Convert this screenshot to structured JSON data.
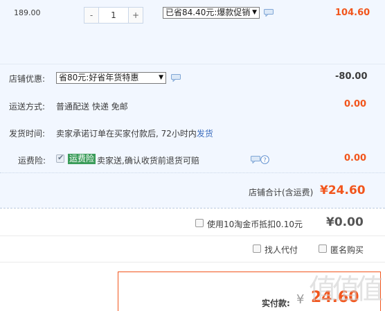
{
  "item": {
    "unit_price": "189.00",
    "qty_minus": "-",
    "qty_value": "1",
    "qty_plus": "+",
    "promo_selected": "已省84.40元:爆款促销",
    "amount": "104.60"
  },
  "shop": {
    "discount_label": "店铺优惠:",
    "discount_selected": "省80元:好省年货特惠",
    "discount_amount": "-80.00",
    "shipping_label": "运送方式:",
    "shipping_text": "普通配送 快递 免邮",
    "shipping_amount": "0.00",
    "dispatch_label": "发货时间:",
    "dispatch_text": "卖家承诺订单在买家付款后, 72小时内",
    "dispatch_link": "发货",
    "insurance_label": "运费险:",
    "insurance_tag": "运费险",
    "insurance_text": "卖家送,确认收货前退货可赔",
    "insurance_amount": "0.00",
    "subtotal_label": "店铺合计(含运费)",
    "subtotal_value": "¥24.60"
  },
  "coins": {
    "label": "使用10淘金币抵扣0.10元",
    "value": "¥0.00"
  },
  "options": {
    "proxy_pay": "找人代付",
    "anonymous": "匿名购买"
  },
  "pay": {
    "label": "实付款:",
    "yen": "¥",
    "value": "24.60"
  },
  "watermark": "值值值",
  "colors": {
    "accent": "#f2551c",
    "panel_bg": "#f2f7ff",
    "insurance_tag": "#3b9c5a",
    "link": "#3c6dbd"
  }
}
